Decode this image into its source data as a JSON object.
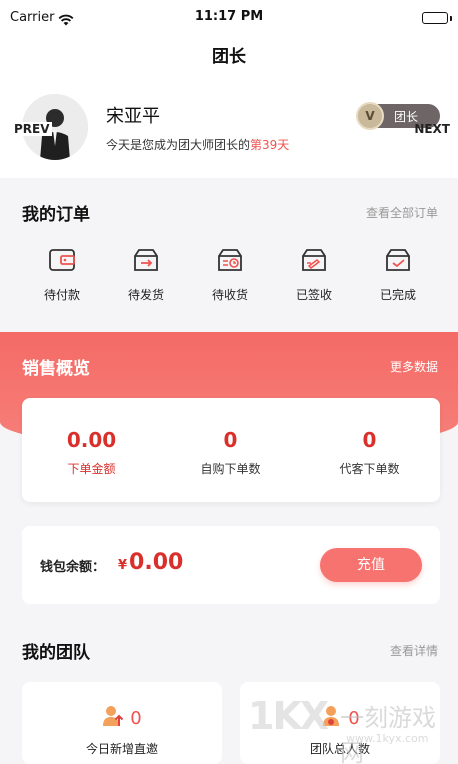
{
  "status_bar": {
    "carrier": "Carrier",
    "time": "11:17 PM"
  },
  "nav": {
    "title": "团长"
  },
  "profile": {
    "name": "宋亚平",
    "subtitle_prefix": "今天是您成为团大师团长的",
    "subtitle_days": "第39天",
    "prev_label": "PREV",
    "next_label": "NEXT",
    "level_coin": "V",
    "level_text": "团长"
  },
  "orders": {
    "title": "我的订单",
    "view_all": "查看全部订单",
    "items": [
      {
        "label": "待付款",
        "icon": "wallet-box-icon"
      },
      {
        "label": "待发货",
        "icon": "box-send-icon"
      },
      {
        "label": "待收货",
        "icon": "box-clock-icon"
      },
      {
        "label": "已签收",
        "icon": "box-sign-icon"
      },
      {
        "label": "已完成",
        "icon": "box-check-icon"
      }
    ]
  },
  "sales": {
    "title": "销售概览",
    "more": "更多数据",
    "stats": [
      {
        "value": "0.00",
        "label": "下单金额"
      },
      {
        "value": "0",
        "label": "自购下单数"
      },
      {
        "value": "0",
        "label": "代客下单数"
      }
    ]
  },
  "wallet": {
    "label": "钱包余额：",
    "currency": "¥",
    "amount": "0.00",
    "recharge": "充值"
  },
  "team": {
    "title": "我的团队",
    "details": "查看详情",
    "cards": [
      {
        "value": "0",
        "label": "今日新增直邀",
        "icon": "person-up-icon"
      },
      {
        "value": "0",
        "label": "团队总人数",
        "icon": "person-group-icon"
      }
    ]
  },
  "watermark": {
    "big": "1KX",
    "cn": "一刻游戏网",
    "url": "www.1kyx.com"
  },
  "colors": {
    "accent": "#f0524f",
    "value_red": "#d9302c",
    "band_start": "#f46a66",
    "band_end": "#f7807a"
  }
}
